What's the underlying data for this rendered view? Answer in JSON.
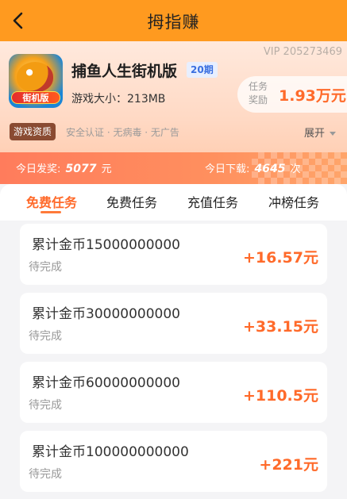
{
  "topbar": {
    "title": "拇指赚"
  },
  "game": {
    "vip": "VIP 205273469",
    "name": "捕鱼人生街机版",
    "period": "20期",
    "size": "游戏大小：213MB",
    "icon_badge": "街机版",
    "reward_label": "任务奖励",
    "reward_value": "1.93万元",
    "qual_tag": "游戏资质",
    "qual_desc": "安全认证 · 无病毒 · 无广告",
    "expand_label": "展开"
  },
  "stats": {
    "today_payout_label": "今日发奖:",
    "today_payout_value": "5077",
    "today_payout_unit": "元",
    "today_download_label": "今日下载:",
    "today_download_value": "4645",
    "today_download_unit": "次"
  },
  "tabs": [
    {
      "label": "免费任务",
      "active": true
    },
    {
      "label": "免费任务",
      "active": false
    },
    {
      "label": "充值任务",
      "active": false
    },
    {
      "label": "冲榜任务",
      "active": false
    }
  ],
  "tasks": [
    {
      "name": "累计金币15000000000",
      "status": "待完成",
      "reward": "+16.57元"
    },
    {
      "name": "累计金币30000000000",
      "status": "待完成",
      "reward": "+33.15元"
    },
    {
      "name": "累计金币60000000000",
      "status": "待完成",
      "reward": "+110.5元"
    },
    {
      "name": "累计金币100000000000",
      "status": "待完成",
      "reward": "+221元"
    }
  ],
  "colors": {
    "accent": "#ff6a2a",
    "topbar": "#ff9a1f"
  }
}
